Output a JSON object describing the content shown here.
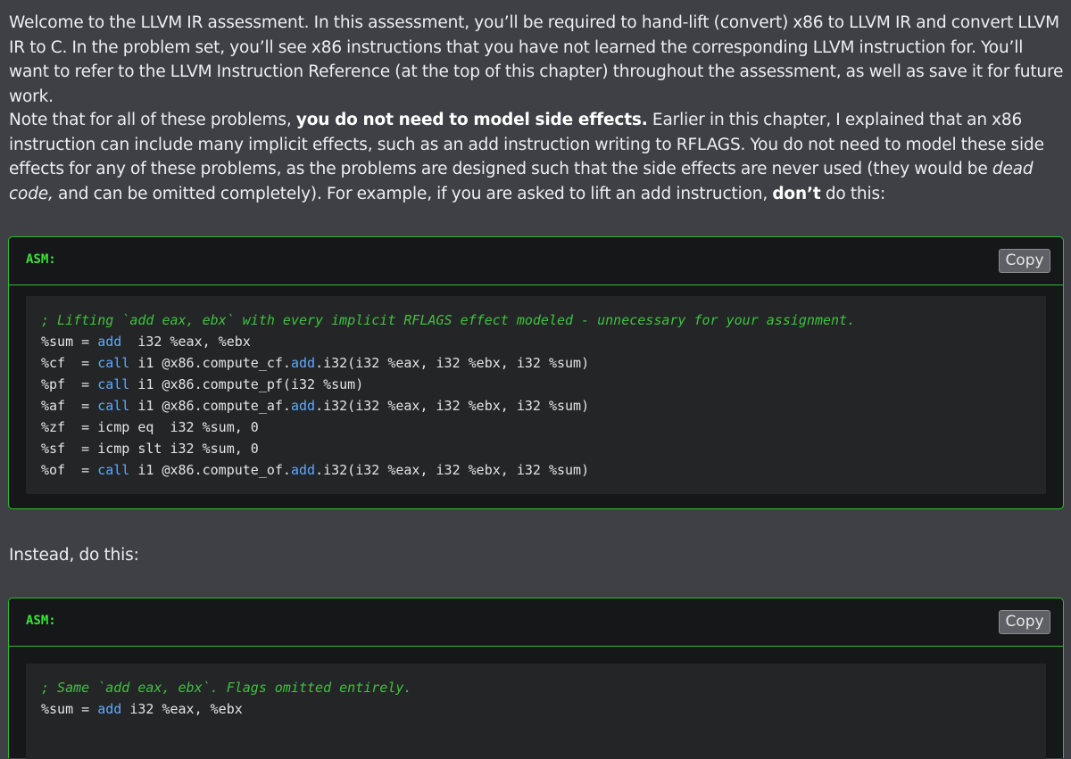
{
  "intro": {
    "paragraph1": "Welcome to the LLVM IR assessment. In this assessment, you’ll be required to hand-lift (convert) x86 to LLVM IR and convert LLVM IR to C. In the problem set, you’ll see x86 instructions that you have not learned the corresponding LLVM instruction for. You’ll want to refer to the LLVM Instruction Reference (at the top of this chapter) throughout the assessment, as well as save it for future work.",
    "paragraph2": {
      "part1": "Note that for all of these problems, ",
      "bold1": "you do not need to model side effects.",
      "part2": " Earlier in this chapter, I explained that an x86 instruction can include many implicit effects, such as an add instruction writing to RFLAGS. You do not need to model these side effects for any of these problems, as the problems are designed such that the side effects are never used (they would be ",
      "italic1": "dead code,",
      "part3": " and can be omitted completely). For example, if you are asked to lift an add instruction, ",
      "bold2": "don’t",
      "part4": " do this:"
    },
    "paragraph3": "Instead, do this:"
  },
  "code_blocks": [
    {
      "label": "ASM:",
      "copy_label": "Copy",
      "lines": [
        [
          {
            "t": "; Lifting `add eax, ebx` with every implicit RFLAGS effect modeled - unnecessary for your assignment.",
            "c": "cm"
          }
        ],
        [
          {
            "t": "%sum = ",
            "c": "nm"
          },
          {
            "t": "add",
            "c": "kw"
          },
          {
            "t": "  i32 %eax, %ebx",
            "c": "nm"
          }
        ],
        [
          {
            "t": "%cf  = ",
            "c": "nm"
          },
          {
            "t": "call",
            "c": "kw"
          },
          {
            "t": " i1 @x86.compute_cf.",
            "c": "nm"
          },
          {
            "t": "add",
            "c": "kw"
          },
          {
            "t": ".i32(i32 %eax, i32 %ebx, i32 %sum)",
            "c": "nm"
          }
        ],
        [
          {
            "t": "%pf  = ",
            "c": "nm"
          },
          {
            "t": "call",
            "c": "kw"
          },
          {
            "t": " i1 @x86.compute_pf(i32 %sum)",
            "c": "nm"
          }
        ],
        [
          {
            "t": "%af  = ",
            "c": "nm"
          },
          {
            "t": "call",
            "c": "kw"
          },
          {
            "t": " i1 @x86.compute_af.",
            "c": "nm"
          },
          {
            "t": "add",
            "c": "kw"
          },
          {
            "t": ".i32(i32 %eax, i32 %ebx, i32 %sum)",
            "c": "nm"
          }
        ],
        [
          {
            "t": "%zf  = icmp eq  i32 %sum, 0",
            "c": "nm"
          }
        ],
        [
          {
            "t": "%sf  = icmp slt i32 %sum, 0",
            "c": "nm"
          }
        ],
        [
          {
            "t": "%of  = ",
            "c": "nm"
          },
          {
            "t": "call",
            "c": "kw"
          },
          {
            "t": " i1 @x86.compute_of.",
            "c": "nm"
          },
          {
            "t": "add",
            "c": "kw"
          },
          {
            "t": ".i32(i32 %eax, i32 %ebx, i32 %sum)",
            "c": "nm"
          }
        ]
      ]
    },
    {
      "label": "ASM:",
      "copy_label": "Copy",
      "lines": [
        [
          {
            "t": "; Same `add eax, ebx`. Flags omitted entirely.",
            "c": "cm"
          }
        ],
        [
          {
            "t": "%sum = ",
            "c": "nm"
          },
          {
            "t": "add",
            "c": "kw"
          },
          {
            "t": " i32 %eax, %ebx",
            "c": "nm"
          }
        ]
      ]
    }
  ],
  "colors": {
    "page_background": "#3e4046",
    "code_background": "#242527",
    "code_border": "#2dbb2d",
    "comment": "#3fc23f",
    "keyword": "#5ea9ff"
  }
}
